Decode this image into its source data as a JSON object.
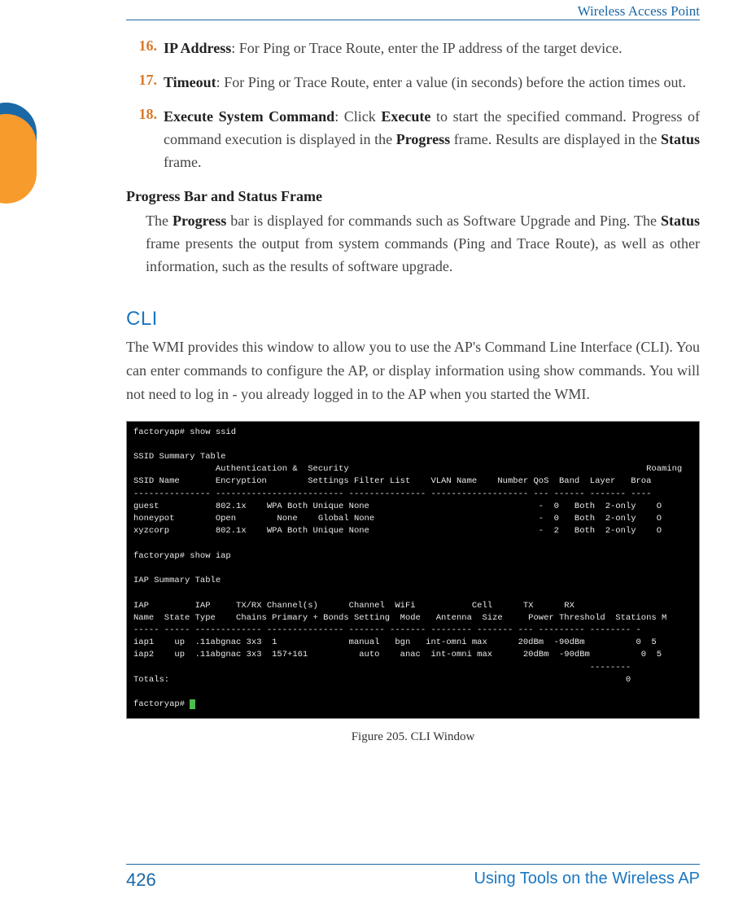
{
  "running_head": "Wireless Access Point",
  "items": [
    {
      "num": "16.",
      "term": "IP Address",
      "text": "For Ping or Trace Route, enter the IP address of the target device."
    },
    {
      "num": "17.",
      "term": "Timeout",
      "text": "For Ping or Trace Route, enter a value (in seconds) before the action times out."
    },
    {
      "num": "18.",
      "term": "Execute System Command",
      "pre": "Click ",
      "bold1": "Execute",
      "mid": " to start the specified command. Progress of command execution is displayed in the ",
      "bold2": "Progress",
      "mid2": " frame. Results are displayed in the ",
      "bold3": "Status",
      "post": " frame."
    }
  ],
  "subhead": "Progress Bar and Status Frame",
  "progress_para": {
    "pre": "The ",
    "b1": "Progress",
    "mid": " bar is displayed for commands such as Software Upgrade and Ping. The ",
    "b2": "Status",
    "post": " frame presents the output from system commands (Ping and Trace Route), as well as other information, such as the results of software upgrade."
  },
  "cli_title": "CLI",
  "cli_para": "The WMI provides this window to allow you to use the AP's Command Line Interface (CLI). You can enter commands to configure the AP, or display information using show commands. You will not need to log in - you already logged in to the AP when you started the WMI.",
  "terminal_text": "factoryap# show ssid\n\nSSID Summary Table\n                Authentication &  Security                                                          Roaming\nSSID Name       Encryption        Settings Filter List    VLAN Name    Number QoS  Band  Layer   Broa\n--------------- ------------------------- --------------- ------------------- --- ------ ------- ----\nguest           802.1x    WPA Both Unique None                                 -  0   Both  2-only    O\nhoneypot        Open        None    Global None                                -  0   Both  2-only    O\nxyzcorp         802.1x    WPA Both Unique None                                 -  2   Both  2-only    O\n\nfactoryap# show iap\n\nIAP Summary Table\n\nIAP         IAP     TX/RX Channel(s)      Channel  WiFi           Cell      TX      RX\nName  State Type    Chains Primary + Bonds Setting  Mode   Antenna  Size     Power Threshold  Stations M\n----- ----- ------------- --------------- ------- ------- -------- ------- --- --------- -------- -\niap1    up  .11abgnac 3x3  1              manual   bgn   int-omni max      20dBm  -90dBm          0  5\niap2    up  .11abgnac 3x3  157+161          auto    anac  int-omni max      20dBm  -90dBm          0  5\n                                                                                         --------\nTotals:                                                                                         0\n\nfactoryap# ",
  "figure_caption": "Figure 205. CLI Window",
  "page_number": "426",
  "footer_title": "Using Tools on the Wireless AP"
}
